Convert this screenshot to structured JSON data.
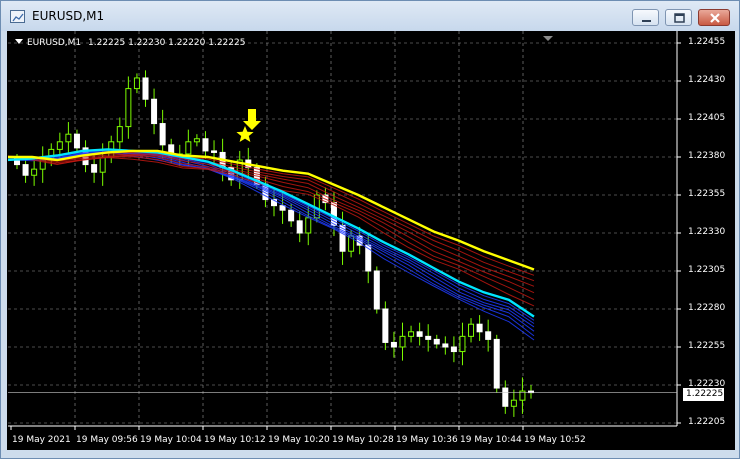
{
  "window": {
    "title": "EURUSD,M1",
    "icon": "chart-window-icon",
    "buttons": [
      "minimize-icon",
      "maximize-icon",
      "close-icon"
    ]
  },
  "chart": {
    "ohlc_symbol": "EURUSD,M1",
    "ohlc_values": "1.22225 1.22230 1.22220 1.22225",
    "current_price": "1.22225",
    "colors": {
      "background": "#000000",
      "grid": "#9a9a9a",
      "bull_candle": "#7cfc00",
      "bear_candle": "#ffffff",
      "ma_fast": "#00e5ff",
      "ma_slow": "#ffff00",
      "short_ribbon": "#1f3cff",
      "long_ribbon": "#c01810",
      "signal_arrow": "#ffff00"
    }
  },
  "chart_data": {
    "type": "line",
    "instrument": "EURUSD",
    "timeframe": "M1",
    "y_ticks": [
      "1.22455",
      "1.22430",
      "1.22405",
      "1.22380",
      "1.22355",
      "1.22330",
      "1.22305",
      "1.22280",
      "1.22255",
      "1.22230",
      "1.22205"
    ],
    "ylim": [
      1.22205,
      1.22455
    ],
    "x_ticks": [
      "19 May 2021",
      "19 May 09:56",
      "19 May 10:04",
      "19 May 10:12",
      "19 May 10:20",
      "19 May 10:28",
      "19 May 10:36",
      "19 May 10:44",
      "19 May 10:52"
    ],
    "grid": true,
    "close_series": [
      1.22375,
      1.22368,
      1.22372,
      1.22378,
      1.22385,
      1.2239,
      1.22395,
      1.22386,
      1.22375,
      1.2237,
      1.2238,
      1.2239,
      1.224,
      1.22425,
      1.22432,
      1.22418,
      1.22402,
      1.22388,
      1.2238,
      1.22382,
      1.2239,
      1.22392,
      1.22384,
      1.22383,
      1.22373,
      1.22365,
      1.22378,
      1.22373,
      1.22362,
      1.22352,
      1.22348,
      1.22345,
      1.22338,
      1.2233,
      1.2234,
      1.22355,
      1.2235,
      1.22335,
      1.22318,
      1.22328,
      1.22322,
      1.22305,
      1.2228,
      1.22258,
      1.22255,
      1.22262,
      1.22265,
      1.22262,
      1.2226,
      1.22257,
      1.22255,
      1.22252,
      1.22262,
      1.2227,
      1.22265,
      1.2226,
      1.22228,
      1.22216,
      1.2222,
      1.22226,
      1.22225
    ],
    "series": [
      {
        "name": "",
        "values": [
          1.22378,
          1.22379,
          1.22381,
          1.22384,
          1.22385,
          1.22384,
          1.22383,
          1.2238,
          1.22377,
          1.22371,
          1.22364,
          1.22357,
          1.22349,
          1.22341,
          1.22333,
          1.22324,
          1.22316,
          1.22307,
          1.22298,
          1.22291,
          1.22286,
          1.22275
        ]
      },
      {
        "name": "",
        "values": [
          1.2238,
          1.2238,
          1.22378,
          1.22381,
          1.22383,
          1.22384,
          1.22384,
          1.22381,
          1.2238,
          1.22377,
          1.22374,
          1.22371,
          1.22369,
          1.22362,
          1.22355,
          1.22347,
          1.22339,
          1.22331,
          1.22325,
          1.22318,
          1.22312,
          1.22306
        ]
      }
    ]
  }
}
